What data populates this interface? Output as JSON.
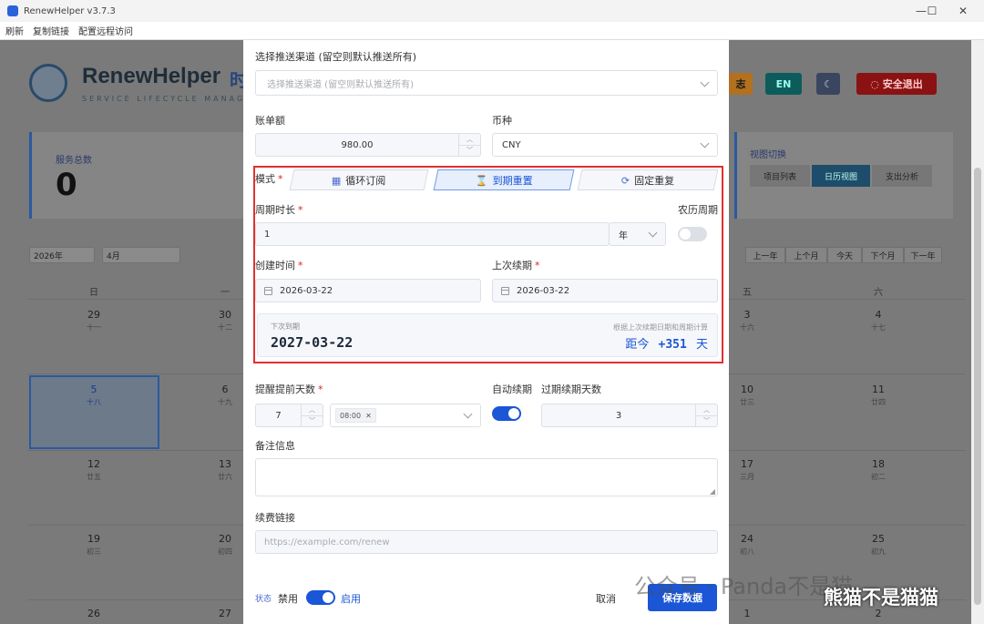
{
  "window": {
    "title": "RenewHelper v3.7.3",
    "min": "—",
    "max": "☐",
    "close": "✕"
  },
  "menu": [
    "刷新",
    "复制链接",
    "配置远程访问"
  ],
  "header": {
    "brand": "RenewHelper",
    "brand_suffix": "时",
    "tagline": "SERVICE LIFECYCLE MANAGEMENT",
    "log_btn": "志",
    "lang_btn": "EN",
    "theme_icon": "☾",
    "logout_label": "安全退出"
  },
  "stat": {
    "label": "服务总数",
    "value": "0"
  },
  "view_switch": {
    "label": "视图切换",
    "options": [
      "项目列表",
      "日历视图",
      "支出分析"
    ],
    "active": 1
  },
  "calendar": {
    "year": "2026年",
    "month": "4月",
    "nav": [
      "上一年",
      "上个月",
      "今天",
      "下个月",
      "下一年"
    ],
    "weekdays": [
      "日",
      "一",
      "五",
      "六"
    ],
    "rows": [
      [
        {
          "d": "29",
          "l": "十一"
        },
        {
          "d": "30",
          "l": "十二"
        },
        {
          "d": "3",
          "l": "十六"
        },
        {
          "d": "4",
          "l": "十七"
        }
      ],
      [
        {
          "d": "5",
          "l": "十八"
        },
        {
          "d": "6",
          "l": "十九"
        },
        {
          "d": "10",
          "l": "廿三"
        },
        {
          "d": "11",
          "l": "廿四"
        }
      ],
      [
        {
          "d": "12",
          "l": "廿五"
        },
        {
          "d": "13",
          "l": "廿六"
        },
        {
          "d": "17",
          "l": "三月"
        },
        {
          "d": "18",
          "l": "初二"
        }
      ],
      [
        {
          "d": "19",
          "l": "初三"
        },
        {
          "d": "20",
          "l": "初四"
        },
        {
          "d": "24",
          "l": "初八"
        },
        {
          "d": "25",
          "l": "初九"
        }
      ],
      [
        {
          "d": "26",
          "l": ""
        },
        {
          "d": "27",
          "l": ""
        },
        {
          "d": "1",
          "l": ""
        },
        {
          "d": "2",
          "l": ""
        }
      ]
    ]
  },
  "form": {
    "channel": {
      "label": "选择推送渠道 (留空则默认推送所有)",
      "placeholder": "选择推送渠道 (留空则默认推送所有)"
    },
    "amount": {
      "label": "账单额",
      "value": "980.00"
    },
    "currency": {
      "label": "币种",
      "value": "CNY"
    },
    "mode": {
      "label": "模式",
      "tabs": [
        "循环订阅",
        "到期重置",
        "固定重复"
      ],
      "active": 1
    },
    "period": {
      "label": "周期时长",
      "value": "1",
      "unit": "年"
    },
    "lunar": {
      "label": "农历周期",
      "on": false
    },
    "created": {
      "label": "创建时间",
      "value": "2026-03-22"
    },
    "last_renew": {
      "label": "上次续期",
      "value": "2026-03-22"
    },
    "next": {
      "label": "下次到期",
      "hint": "根据上次续期日期和周期计算",
      "date": "2027-03-22",
      "prefix": "距今",
      "days": "+351",
      "suffix": "天"
    },
    "remind": {
      "label": "提醒提前天数",
      "value": "7",
      "time_tag": "08:00"
    },
    "auto_renew": {
      "label": "自动续期",
      "on": true
    },
    "overdue": {
      "label": "过期续期天数",
      "value": "3"
    },
    "note": {
      "label": "备注信息"
    },
    "link": {
      "label": "续费链接",
      "placeholder": "https://example.com/renew"
    },
    "status": {
      "label": "状态",
      "off": "禁用",
      "on": "启用"
    },
    "cancel": "取消",
    "save": "保存数据"
  },
  "watermark": {
    "text": "公众号 · Panda不是猫",
    "text2": "熊猫不是猫猫"
  }
}
